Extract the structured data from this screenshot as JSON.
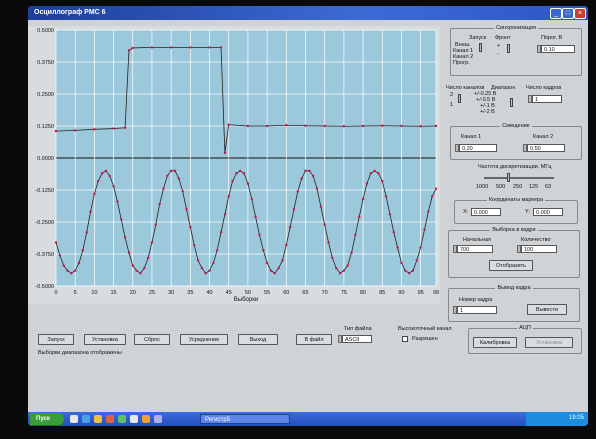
{
  "window": {
    "title": "Осциллограф PMC 6"
  },
  "plot": {
    "xlabel": "Выборки",
    "y_ticks": [
      "0.5000",
      "0.3750",
      "0.2500",
      "0.1250",
      "0.0000",
      "-0.1250",
      "-0.2500",
      "-0.3750",
      "-0.5000"
    ],
    "x_ticks": [
      "0",
      "5",
      "10",
      "15",
      "20",
      "25",
      "30",
      "35",
      "40",
      "45",
      "50",
      "55",
      "60",
      "65",
      "70",
      "75",
      "80",
      "85",
      "90",
      "95",
      "99"
    ]
  },
  "chart_data": {
    "type": "line",
    "xlabel": "Выборки",
    "x_range": [
      0,
      99
    ],
    "y_range": [
      -0.5,
      0.5
    ],
    "grid": true,
    "series": [
      {
        "color": "#cc1144",
        "x": [
          0,
          5,
          10,
          15,
          18,
          19,
          20,
          25,
          30,
          35,
          40,
          43,
          44,
          45,
          50,
          55,
          60,
          65,
          70,
          75,
          80,
          85,
          90,
          95,
          99
        ],
        "values": [
          0.105,
          0.108,
          0.112,
          0.115,
          0.118,
          0.42,
          0.43,
          0.432,
          0.432,
          0.432,
          0.432,
          0.432,
          0.02,
          0.13,
          0.125,
          0.125,
          0.128,
          0.126,
          0.125,
          0.124,
          0.125,
          0.126,
          0.125,
          0.124,
          0.125
        ]
      },
      {
        "color": "#cc1144",
        "x": [
          0,
          1,
          2,
          3,
          4,
          5,
          6,
          7,
          8,
          9,
          10,
          11,
          12,
          13,
          14,
          15,
          16,
          17,
          18,
          19,
          20,
          21,
          22,
          23,
          24,
          25,
          26,
          27,
          28,
          29,
          30,
          31,
          32,
          33,
          34,
          35,
          36,
          37,
          38,
          39,
          40,
          41,
          42,
          43,
          44,
          45,
          46,
          47,
          48,
          49,
          50,
          51,
          52,
          53,
          54,
          55,
          56,
          57,
          58,
          59,
          60,
          61,
          62,
          63,
          64,
          65,
          66,
          67,
          68,
          69,
          70,
          71,
          72,
          73,
          74,
          75,
          76,
          77,
          78,
          79,
          80,
          81,
          82,
          83,
          84,
          85,
          86,
          87,
          88,
          89,
          90,
          91,
          92,
          93,
          94,
          95,
          96,
          97,
          98,
          99
        ],
        "values": [
          -0.33,
          -0.38,
          -0.42,
          -0.44,
          -0.45,
          -0.44,
          -0.41,
          -0.36,
          -0.29,
          -0.21,
          -0.14,
          -0.09,
          -0.06,
          -0.05,
          -0.07,
          -0.11,
          -0.17,
          -0.24,
          -0.31,
          -0.37,
          -0.42,
          -0.44,
          -0.45,
          -0.43,
          -0.39,
          -0.33,
          -0.26,
          -0.18,
          -0.12,
          -0.07,
          -0.05,
          -0.05,
          -0.08,
          -0.13,
          -0.2,
          -0.27,
          -0.34,
          -0.4,
          -0.43,
          -0.45,
          -0.44,
          -0.41,
          -0.36,
          -0.29,
          -0.22,
          -0.15,
          -0.09,
          -0.06,
          -0.05,
          -0.06,
          -0.1,
          -0.16,
          -0.23,
          -0.3,
          -0.36,
          -0.41,
          -0.44,
          -0.45,
          -0.43,
          -0.4,
          -0.34,
          -0.27,
          -0.2,
          -0.13,
          -0.08,
          -0.05,
          -0.05,
          -0.07,
          -0.12,
          -0.19,
          -0.26,
          -0.33,
          -0.39,
          -0.43,
          -0.45,
          -0.44,
          -0.42,
          -0.37,
          -0.3,
          -0.23,
          -0.16,
          -0.1,
          -0.06,
          -0.05,
          -0.06,
          -0.09,
          -0.15,
          -0.22,
          -0.29,
          -0.35,
          -0.41,
          -0.44,
          -0.45,
          -0.44,
          -0.4,
          -0.35,
          -0.28,
          -0.21,
          -0.15,
          -0.12
        ]
      }
    ]
  },
  "sync": {
    "title": "Синхронизация",
    "start_label": "Запуск",
    "front_label": "Фронт",
    "level_label": "Порог, В",
    "modes": [
      "Внеш.",
      "Канал 1",
      "Канал 2",
      "Прогр."
    ],
    "front_options": [
      "+",
      "-"
    ],
    "level_value": "0.10"
  },
  "channels": {
    "count_label": "Число каналов",
    "count_options": [
      "2",
      "1"
    ],
    "range_label": "Диапазон",
    "range_options": [
      "+/-0.25 В",
      "+/-0.5 В",
      "+/-1 В",
      "+/-2 В"
    ],
    "frames_label": "Число кадров",
    "frames_value": "1"
  },
  "offset": {
    "title": "Смещение",
    "ch1_label": "Канал 1",
    "ch1_value": "0.20",
    "ch2_label": "Канал 2",
    "ch2_value": "0.50"
  },
  "sampling": {
    "label": "Частота дискретизации, МГц",
    "ticks": [
      "1000",
      "500",
      "250",
      "125",
      "63"
    ],
    "level": 0.35
  },
  "marker": {
    "title": "Координаты маркера",
    "x_label": "X:",
    "x_value": "0.000",
    "y_label": "Y:",
    "y_value": "0.000"
  },
  "selection": {
    "title": "Выборка в кадре",
    "start_label": "Начальная",
    "start_value": "700",
    "count_label": "Количество",
    "count_value": "100",
    "show_button": "Отобразить"
  },
  "frame_out": {
    "title": "Вывод кадра",
    "number_label": "Номер кадра",
    "number_value": "1",
    "output_button": "Вывести"
  },
  "adc": {
    "title": "АЦП",
    "calibrate_button": "Калибровка",
    "adjust_button": "Установка"
  },
  "toolbar": {
    "start": "Запуск",
    "install": "Установка",
    "reset": "Сброс",
    "average": "Усреднение",
    "exit": "Выход",
    "to_file": "В файл",
    "file_type_label": "Тип файла",
    "file_type_value": "ASCII",
    "hires_label": "Высокоточный канал",
    "allow_label": "Разрешен",
    "status": "Выборки диапазона отображены"
  },
  "taskbar": {
    "start": "Пуск",
    "task": "Регистр5",
    "clock": "19:05"
  }
}
